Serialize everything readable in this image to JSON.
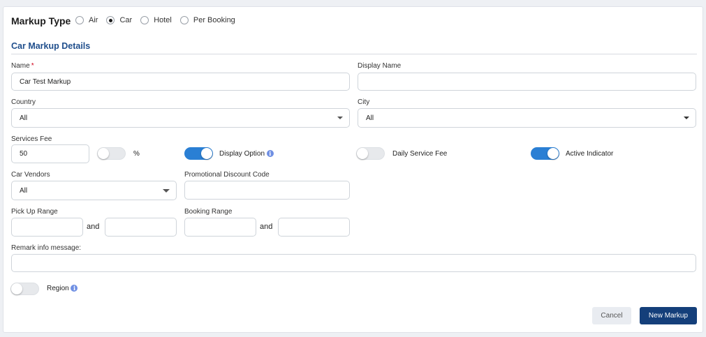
{
  "markup_type": {
    "label": "Markup Type",
    "options": [
      {
        "label": "Air",
        "checked": false
      },
      {
        "label": "Car",
        "checked": true
      },
      {
        "label": "Hotel",
        "checked": false
      },
      {
        "label": "Per Booking",
        "checked": false
      }
    ]
  },
  "section_title": "Car Markup Details",
  "name": {
    "label": "Name",
    "required_mark": "*",
    "value": "Car Test Markup"
  },
  "display_name": {
    "label": "Display Name",
    "value": ""
  },
  "country": {
    "label": "Country",
    "value": "All"
  },
  "city": {
    "label": "City",
    "value": "All"
  },
  "services_fee": {
    "label": "Services Fee",
    "value": "50",
    "percent_label": "%",
    "percent_on": false
  },
  "display_option": {
    "label": "Display Option",
    "on": true,
    "info": "i"
  },
  "daily_service_fee": {
    "label": "Daily Service Fee",
    "on": false
  },
  "active_indicator": {
    "label": "Active Indicator",
    "on": true
  },
  "car_vendors": {
    "label": "Car Vendors",
    "value": "All"
  },
  "promo_code": {
    "label": "Promotional Discount Code",
    "value": ""
  },
  "pickup_range": {
    "label": "Pick Up Range",
    "from": "",
    "and_label": "and",
    "to": ""
  },
  "booking_range": {
    "label": "Booking Range",
    "from": "",
    "and_label": "and",
    "to": ""
  },
  "remark": {
    "label": "Remark info message:",
    "value": ""
  },
  "region": {
    "label": "Region",
    "on": false,
    "info": "i"
  },
  "buttons": {
    "cancel": "Cancel",
    "new_markup": "New Markup"
  },
  "colors": {
    "accent": "#2a7fd4",
    "primary_button": "#143f7a",
    "section_title": "#1f4e8c",
    "required": "#d0021b"
  }
}
